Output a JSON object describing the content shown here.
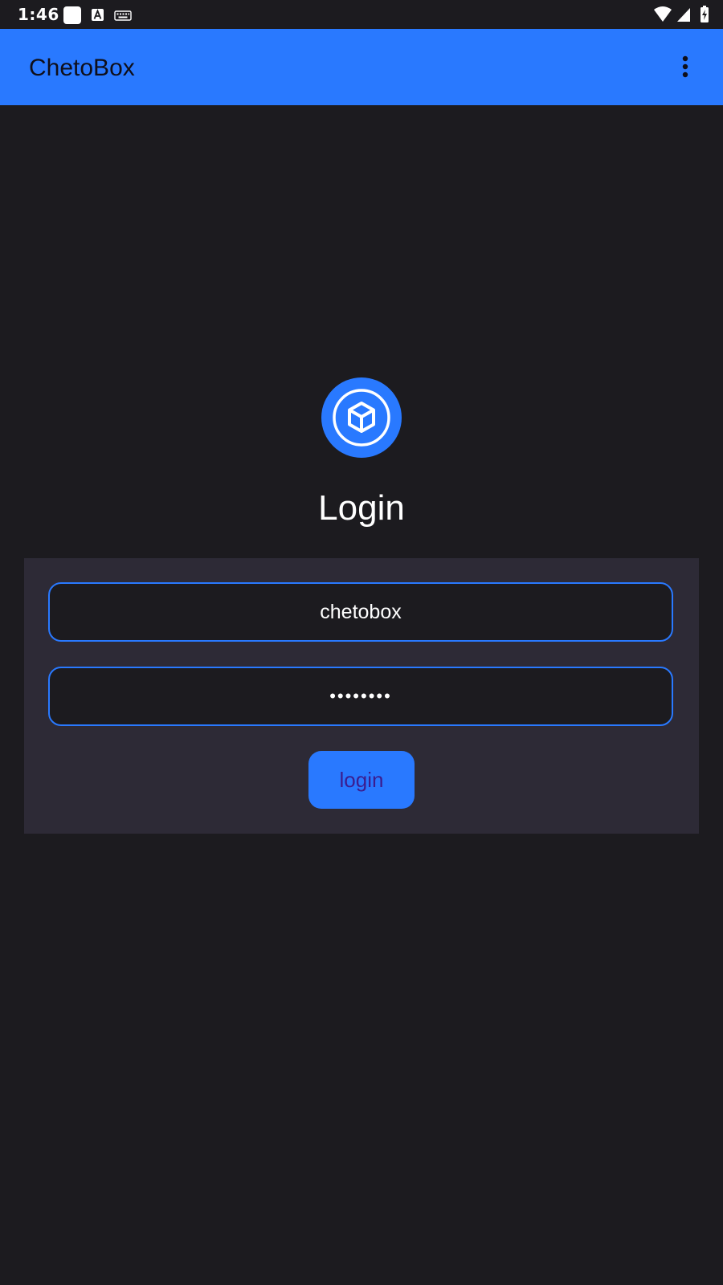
{
  "status_bar": {
    "time": "1:46",
    "notification_icons": [
      "blank-square-icon",
      "text-a-icon",
      "keyboard-icon"
    ],
    "system_icons": [
      "wifi-icon",
      "cell-signal-icon",
      "battery-charging-icon"
    ]
  },
  "app_bar": {
    "title": "ChetoBox",
    "menu_icon": "more-vert-icon"
  },
  "logo": {
    "icon": "cube-icon"
  },
  "login": {
    "heading": "Login",
    "username_value": "chetobox",
    "password_value": "••••••••",
    "button_label": "login"
  },
  "colors": {
    "background": "#1c1b1f",
    "primary": "#2979ff",
    "card": "#2d2a36",
    "button_text": "#3b1d8f"
  }
}
